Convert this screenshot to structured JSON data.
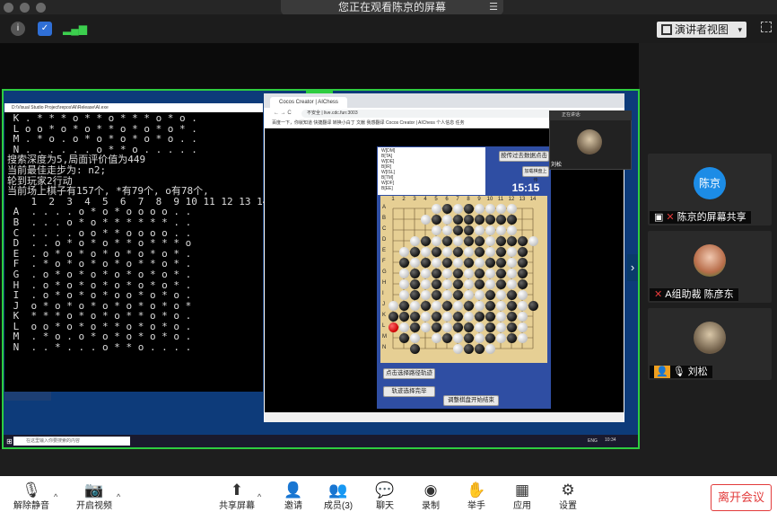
{
  "window": {
    "banner": "您正在观看陈京的屏幕"
  },
  "topbar": {
    "speaker_view": "演讲者视图",
    "caret": "▾",
    "menu_glyph": "☰"
  },
  "shared_screen": {
    "cmd_title": "D:\\Visual Studio Project\\repos\\AI\\Release\\AI.exe",
    "cmd_lines": [
      " K . * * * o * * o * * * o * o .",
      " L o o * o * o * * o * o * o * .",
      " M . * o . o * o * o * o * o . .",
      " N . . . . . . o * * o . . . . .",
      "搜索深度为5,局面评价值为449",
      "当前最佳走步为: n2;",
      "",
      "轮到玩家2行动",
      "当前场上棋子有157个, *有79个, o有78个,",
      "    1  2  3  4  5  6  7  8  9 10 11 12 13 14",
      " A  . . . . o * o * o o o o . .",
      " B  . . . o * o * * * * * * . .",
      " C  . . . . o o * * o o o o . .",
      " D  . . o * o * o * * o * * * o",
      " E  . o * o * o * o * o * o * .",
      " F  . * o * o * o * o * * o * .",
      " G  . o * o * o * o * o * o * .",
      " H  . o * o * o * o * o * o * .",
      " I  . o * o * o * o o * o * o .",
      " J  o * o * o * o * o * o * o *",
      " K  * * * o * o * o * * o * o .",
      " L  o o * o * o * * o * o * o .",
      " M  . * o . o * o * o * o * o .",
      " N  . . * . . . o * * o . . . ."
    ],
    "browser_tab": "Cocos Creator | AIChess",
    "browser_url": "不安全 | live.cdc.fun:3003",
    "bookmarks": "百度一下，你就知道   快捷翻译   转换小白丁   文献   我感翻译   Cocos Creator | AIChess   个人信息   任务",
    "log_entries": [
      "W[DM]",
      "B[TA]",
      "W[DE]",
      "B[IR]",
      "W[ISL]",
      "B[TM]",
      "W[DF]",
      "B[EE]"
    ],
    "btn_upload": "按传过去数据点击",
    "btn_load": "加载棋盘上传",
    "timer": "15:15",
    "col_labels": [
      "1",
      "2",
      "3",
      "4",
      "5",
      "6",
      "7",
      "8",
      "9",
      "10",
      "11",
      "12",
      "13",
      "14"
    ],
    "row_labels": [
      "A",
      "B",
      "C",
      "D",
      "E",
      "F",
      "G",
      "H",
      "I",
      "J",
      "K",
      "L",
      "M",
      "N"
    ],
    "btn_click_track": "点击选择路径轨迹",
    "btn_track_done": "轨迹选择完毕",
    "btn_adjust": "调整棋盘开始结束",
    "webcam_title": "正在讲话:",
    "webcam_name": "刘松",
    "taskbar_search": "在这里输入你要搜索的内容",
    "taskbar_lang": "ENG",
    "taskbar_time": "10:34"
  },
  "participants": [
    {
      "name": "陈京的屏幕共享",
      "avatar_text": "陈京",
      "avatar_color": "#1c8ce6"
    },
    {
      "name": "A组助裁 陈彦东",
      "avatar_text": ""
    },
    {
      "name": "刘松",
      "avatar_text": ""
    }
  ],
  "toolbar": {
    "unmute": "解除静音",
    "start_video": "开启视频",
    "share_screen": "共享屏幕",
    "invite": "邀请",
    "members": "成员(3)",
    "chat": "聊天",
    "record": "录制",
    "raise_hand": "举手",
    "apps": "应用",
    "settings": "设置",
    "leave": "离开会议"
  },
  "colors": {
    "accent": "#1c8ce6",
    "leave": "#e23a3a",
    "frame": "#2ecc40"
  }
}
